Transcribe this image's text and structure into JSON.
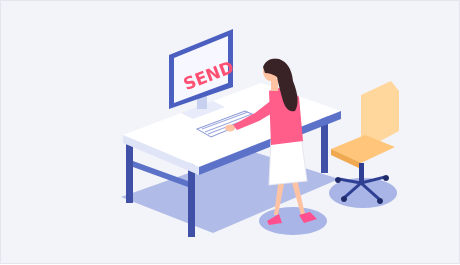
{
  "illustration": {
    "monitor_text": "SEND"
  },
  "colors": {
    "background": "#f3f4f9",
    "floor_shadow": "#a8b5e6",
    "desk_top": "#ffffff",
    "desk_edge": "#5c72c9",
    "desk_legs": "#3f50a6",
    "monitor_frame": "#4a5fc0",
    "screen": "#f7f8ff",
    "send_text": "#ff4f72",
    "keyboard": "#ffffff",
    "shirt": "#ff5d8a",
    "skirt": "#ffffff",
    "hair": "#3a2326",
    "skin": "#ffc3a4",
    "shoes": "#ff4f8e",
    "chair_seat": "#ffc57a",
    "chair_back": "#ffd69b",
    "chair_base": "#2f3f93"
  }
}
